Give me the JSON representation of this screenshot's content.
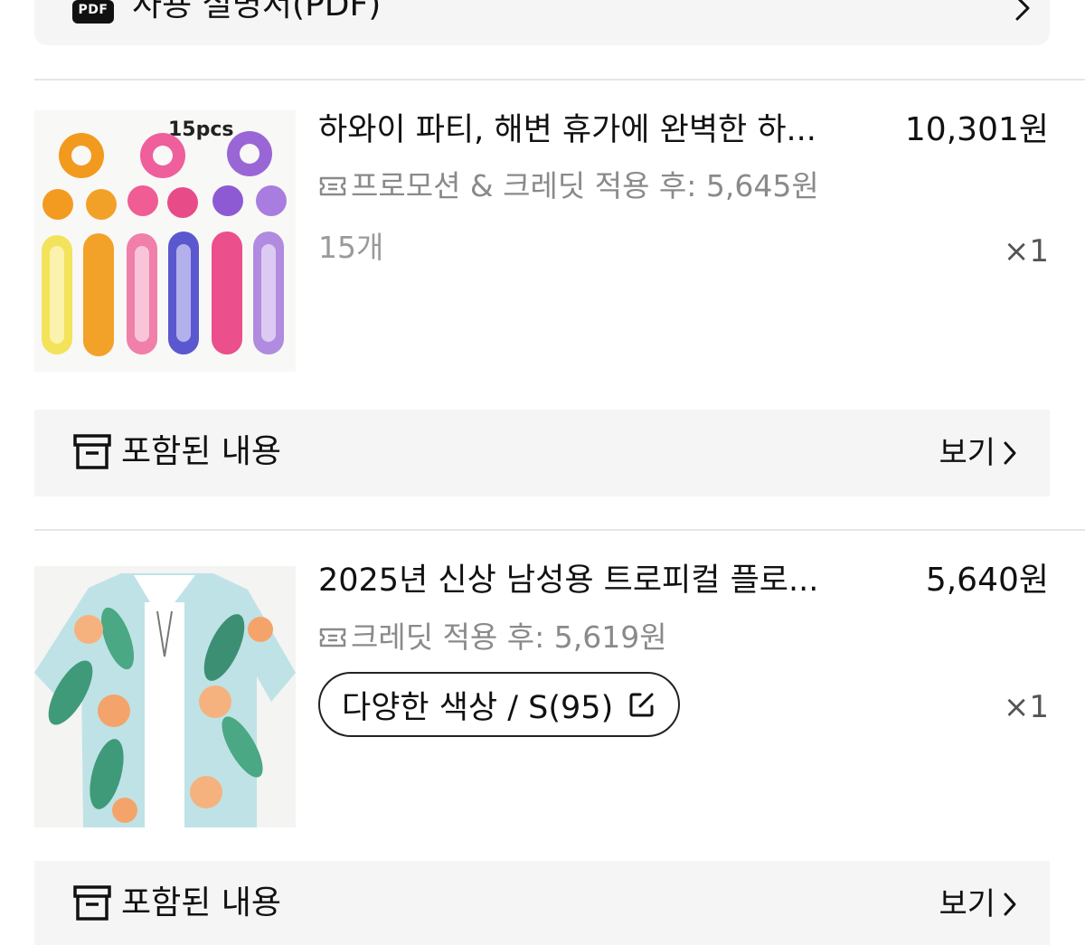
{
  "manual": {
    "pdf_badge": "PDF",
    "label": "사용 설명서(PDF)"
  },
  "products": [
    {
      "title": "하와이 파티, 해변 휴가에 완벽한 하...",
      "price": "10,301원",
      "credit_text": "프로모션 & 크레딧 적용 후: 5,645원",
      "variant": "15개",
      "quantity": "×1",
      "image_caption": "15pcs"
    },
    {
      "title": "2025년 신상 남성용 트로피컬 플로...",
      "price": "5,640원",
      "credit_text": "크레딧 적용 후: 5,619원",
      "variant": "다양한 색상 / S(95)",
      "quantity": "×1"
    }
  ],
  "included": {
    "label": "포함된 내용",
    "view_label": "보기"
  },
  "colors": {
    "bar_bg": "#f5f5f5",
    "muted_text": "#8a8a8a",
    "divider": "#e6e6e6"
  }
}
